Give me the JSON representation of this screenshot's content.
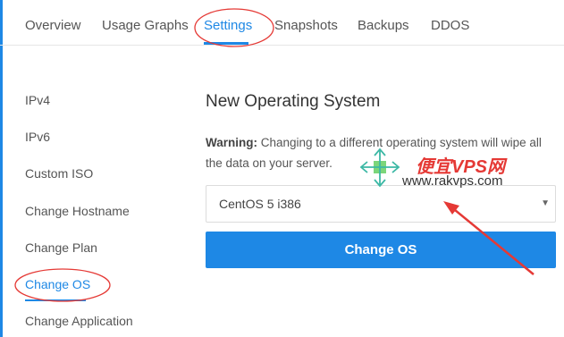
{
  "tabs": [
    {
      "label": "Overview"
    },
    {
      "label": "Usage Graphs"
    },
    {
      "label": "Settings",
      "active": true
    },
    {
      "label": "Snapshots"
    },
    {
      "label": "Backups"
    },
    {
      "label": "DDOS"
    }
  ],
  "sidebar": {
    "items": [
      {
        "label": "IPv4"
      },
      {
        "label": "IPv6"
      },
      {
        "label": "Custom ISO"
      },
      {
        "label": "Change Hostname"
      },
      {
        "label": "Change Plan"
      },
      {
        "label": "Change OS",
        "active": true
      },
      {
        "label": "Change Application"
      }
    ]
  },
  "main": {
    "heading": "New Operating System",
    "warning_label": "Warning:",
    "warning_text": " Changing to a different operating system will wipe all the data on your server.",
    "os_select": {
      "value": "CentOS 5 i386"
    },
    "change_button": "Change OS"
  },
  "watermark": {
    "brand": "便宜VPS网",
    "url": "www.rakvps.com"
  },
  "colors": {
    "accent": "#1e88e5",
    "annotation": "#e53935"
  }
}
